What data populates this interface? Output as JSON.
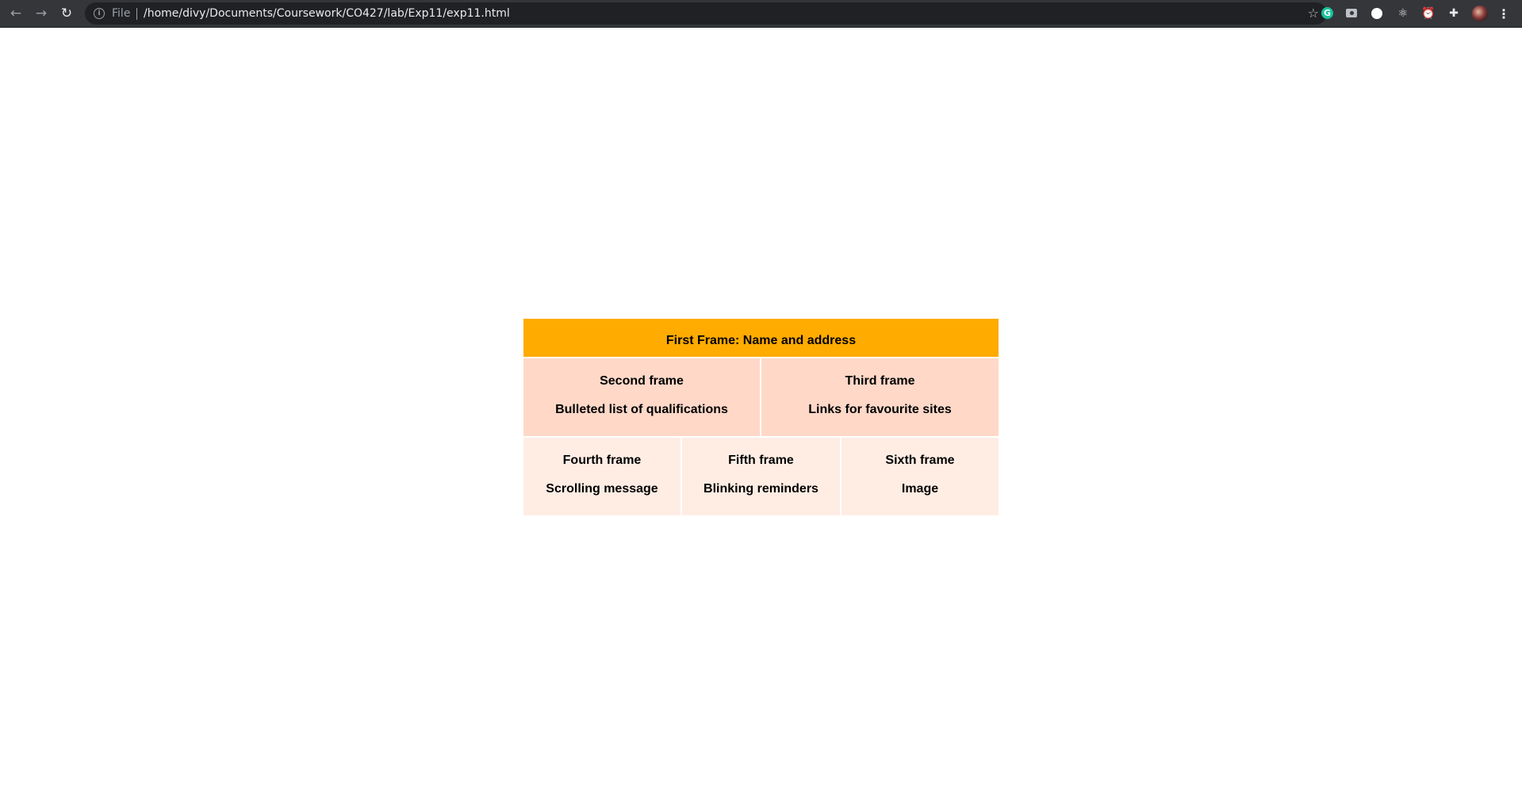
{
  "browser": {
    "back_icon": "←",
    "forward_icon": "→",
    "reload_icon": "↻",
    "scheme_label": "File",
    "url": "/home/divy/Documents/Coursework/CO427/lab/Exp11/exp11.html",
    "star_icon": "☆",
    "extensions": {
      "grammarly": "G",
      "puzzle": "✚",
      "menu": "⋮"
    }
  },
  "page": {
    "first_frame": "First Frame: Name and address",
    "second_frame": {
      "title": "Second frame",
      "subtitle": "Bulleted list of qualifications"
    },
    "third_frame": {
      "title": "Third frame",
      "subtitle": "Links for favourite sites"
    },
    "fourth_frame": {
      "title": "Fourth frame",
      "subtitle": "Scrolling message"
    },
    "fifth_frame": {
      "title": "Fifth frame",
      "subtitle": "Blinking reminders"
    },
    "sixth_frame": {
      "title": "Sixth frame",
      "subtitle": "Image"
    },
    "colors": {
      "header": "#ffab00",
      "row2": "#ffd8c8",
      "row3": "#ffede4"
    }
  }
}
